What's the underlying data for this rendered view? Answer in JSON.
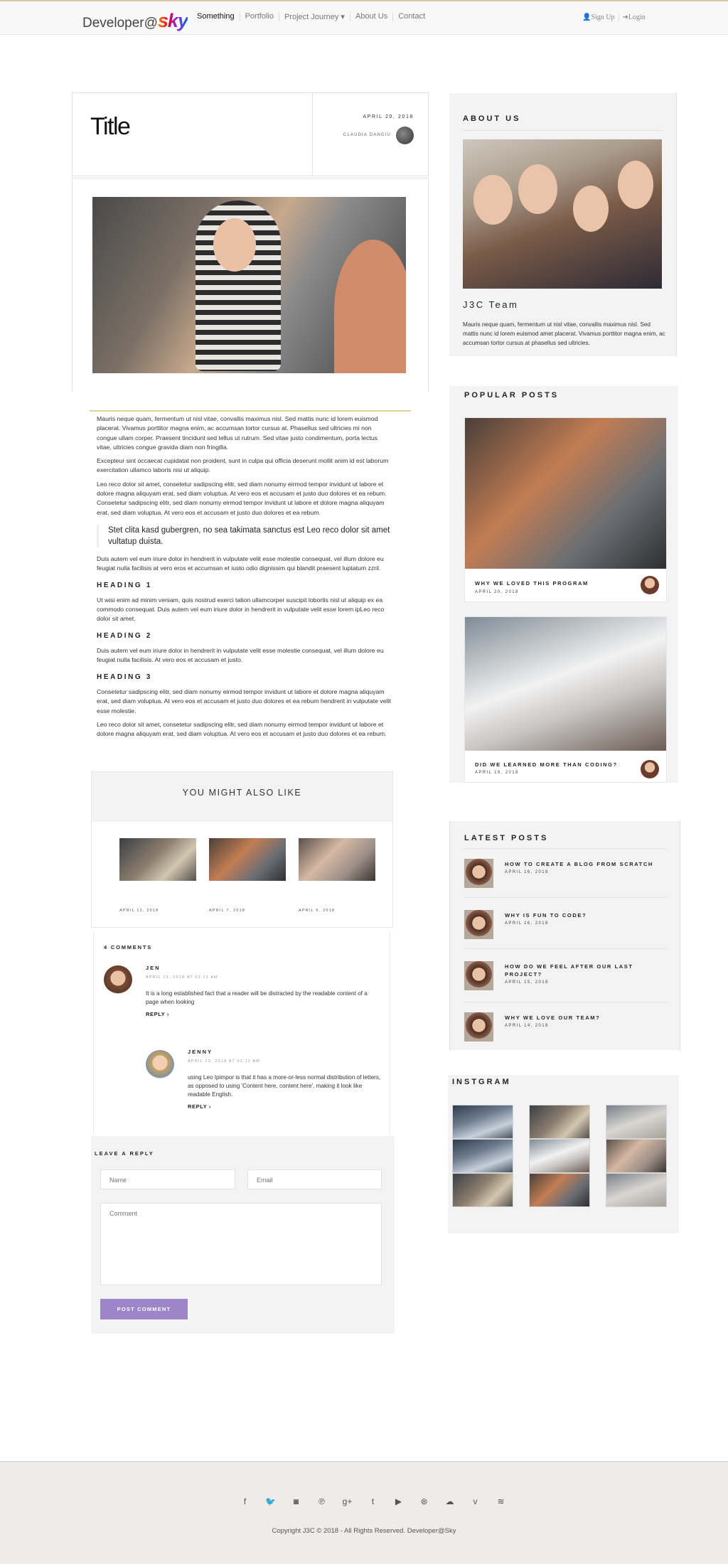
{
  "brand": {
    "prefix": "Developer@",
    "sky": "sky"
  },
  "nav": {
    "items": [
      "Something",
      "Portfolio",
      "Project Journey ▾",
      "About Us",
      "Contact"
    ],
    "signup": "👤Sign Up",
    "login": "➜Login"
  },
  "post": {
    "title": "Title",
    "date": "APRIL 20, 2018",
    "author": "CLAUDIA DANCIU",
    "paragraphs": [
      "Mauris neque quam, fermentum ut nisl vitae, convallis maximus nisl. Sed mattis nunc id lorem euismod placerat. Vivamus porttitor magna enim, ac accumsan tortor cursus at. Phasellus sed ultricies mi non congue ullam corper. Praesent tincidunt sed tellus ut rutrum. Sed vitae justo condimentum, porta lectus vitae, ultricies congue gravida diam non fringilla.",
      "Excepteur sint occaecat cupidatat non proident, sunt in culpa qui officia deserunt mollit anim id est laborum exercitation ullamco laboris nisi ut aliquip.",
      "Leo reco dolor sit amet, consetetur sadipscing elitr, sed diam nonumy eirmod tempor invidunt ut labore et dolore magna aliquyam erat, sed diam voluptua. At vero eos et accusam et justo duo dolores et ea rebum. Consetetur sadipscing elitr, sed diam nonumy eirmod tempor invidunt ut labore et dolore magna aliquyam erat, sed diam voluptua. At vero eos et accusam et justo duo dolores et ea rebum.",
      "Stet clita kasd gubergren, no sea takimata sanctus est Leo reco dolor sit amet vultatup duista.",
      "Duis autem vel eum iriure dolor in hendrerit in vulputate velit esse molestie consequat, vel illum dolore eu feugiat nulla facilisis at vero eros et accumsan et iusto odio dignissim qui blandit praesent luptatum zzril.",
      "HEADING 1",
      "Ut wisi enim ad minim veniam, quis nostrud exerci tation ullamcorper suscipit lobortis nisl ut aliquip ex ea commodo consequat. Duis autem vel eum iriure dolor in hendrerit in vulputate velit esse lorem ipLeo reco dolor sit amet.",
      "HEADING 2",
      "Duis autem vel eum iriure dolor in hendrerit in vulputate velit esse molestie consequat, vel illum dolore eu feugiat nulla facilisis. At vero eos et accusam et justo.",
      "HEADING 3",
      "Consetetur sadipscing elitr, sed diam nonumy eirmod tempor invidunt ut labore et dolore magna aliquyam erat, sed diam voluptua. At vero eos et accusam et justo duo dolores et ea rebum hendrerit in vulputate velit esse molestie.",
      "Leo reco dolor sit amet, consetetur sadipscing elitr, sed diam nonumy eirmod tempor invidunt ut labore et dolore magna aliquyam erat, sed diam voluptua. At vero eos et accusam et justo duo dolores et ea rebum."
    ]
  },
  "related": {
    "title": "YOU MIGHT ALSO LIKE",
    "items": [
      {
        "date": "APRIL 12, 2018"
      },
      {
        "date": "APRIL 7, 2018"
      },
      {
        "date": "APRIL 6, 2018"
      }
    ]
  },
  "comments": {
    "count": "4 COMMENTS",
    "items": [
      {
        "name": "JEN",
        "date": "APRIL 13, 2018 AT 01:11 AM",
        "text": "It is a long established fact that a reader will be distracted by the readable content of a page when looking",
        "reply": "REPLY ›"
      },
      {
        "name": "JENNY",
        "date": "APRIL 13, 2018 AT 01:11 AM",
        "text": "using Leo Ipimpor is that it has a more-or-less normal distribution of letters, as opposed to using 'Content here, content here', making it look like readable English.",
        "reply": "REPLY ›"
      }
    ]
  },
  "reply_form": {
    "title": "LEAVE A REPLY",
    "name_placeholder": "Name",
    "email_placeholder": "Email",
    "comment_placeholder": "Comment",
    "submit": "POST COMMENT"
  },
  "sidebar": {
    "about": {
      "title": "ABOUT US",
      "name": "J3C Team",
      "text": "Mauris neque quam, fermentum ut nisl vitae, convallis maximus nisl. Sed mattis nunc id lorem euismod amet placerat. Vivamus porttitor magna enim, ac accumsan tortor cursus at phasellus sed ultricies."
    },
    "popular": {
      "title": "POPULAR POSTS",
      "items": [
        {
          "title": "WHY WE LOVED THIS PROGRAM",
          "date": "APRIL 20, 2018"
        },
        {
          "title": "DID WE LEARNED MORE THAN CODING?",
          "date": "APRIL 19, 2018"
        }
      ]
    },
    "latest": {
      "title": "LATEST POSTS",
      "items": [
        {
          "title": "HOW TO CREATE A BLOG FROM SCRATCH",
          "date": "APRIL 16, 2018"
        },
        {
          "title": "WHY IS FUN TO CODE?",
          "date": "APRIL 16, 2018"
        },
        {
          "title": "HOW DO WE FEEL AFTER OUR LAST PROJECT?",
          "date": "APRIL 15, 2018"
        },
        {
          "title": "WHY WE LOVE OUR TEAM?",
          "date": "APRIL 14, 2018"
        }
      ]
    },
    "instagram": {
      "title": "INSTGRAM"
    }
  },
  "footer": {
    "social_icons": [
      "facebook-icon",
      "twitter-icon",
      "instagram-icon",
      "pinterest-icon",
      "google-plus-icon",
      "tumblr-icon",
      "youtube-icon",
      "dribbble-icon",
      "soundcloud-icon",
      "vimeo-icon",
      "rss-icon"
    ],
    "social_glyphs": [
      "f",
      "🐦",
      "◙",
      "℗",
      "g+",
      "t",
      "▶",
      "⊛",
      "☁",
      "v",
      "≋"
    ],
    "copyright": "Copyright J3C © 2018 - All Rights Reserved. Developer@Sky"
  }
}
